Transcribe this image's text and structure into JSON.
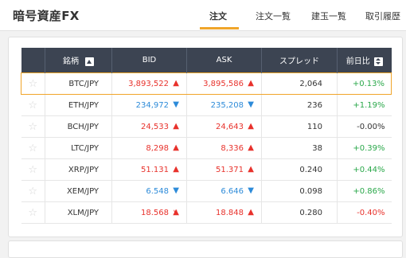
{
  "header": {
    "title": "暗号資産FX",
    "tabs": [
      {
        "label": "注文",
        "active": true
      },
      {
        "label": "注文一覧",
        "active": false
      },
      {
        "label": "建玉一覧",
        "active": false
      },
      {
        "label": "取引履歴",
        "active": false
      }
    ]
  },
  "colors": {
    "accent": "#f0a52a",
    "table_header_bg": "#3c4452",
    "up": "#e8322c",
    "down": "#2d8bd9",
    "positive_change": "#2aa84a",
    "negative_change": "#e8322c"
  },
  "table": {
    "columns": {
      "symbol": "銘柄",
      "bid": "BID",
      "ask": "ASK",
      "spread": "スプレッド",
      "change": "前日比"
    },
    "rows": [
      {
        "pair": "BTC/JPY",
        "bid": "3,893,522",
        "bid_dir": "up",
        "ask": "3,895,586",
        "ask_dir": "up",
        "spread": "2,064",
        "change": "+0.13%",
        "change_sign": "pos",
        "selected": true
      },
      {
        "pair": "ETH/JPY",
        "bid": "234,972",
        "bid_dir": "down",
        "ask": "235,208",
        "ask_dir": "down",
        "spread": "236",
        "change": "+1.19%",
        "change_sign": "pos",
        "selected": false
      },
      {
        "pair": "BCH/JPY",
        "bid": "24,533",
        "bid_dir": "up",
        "ask": "24,643",
        "ask_dir": "up",
        "spread": "110",
        "change": "-0.00%",
        "change_sign": "zero",
        "selected": false
      },
      {
        "pair": "LTC/JPY",
        "bid": "8,298",
        "bid_dir": "up",
        "ask": "8,336",
        "ask_dir": "up",
        "spread": "38",
        "change": "+0.39%",
        "change_sign": "pos",
        "selected": false
      },
      {
        "pair": "XRP/JPY",
        "bid": "51.131",
        "bid_dir": "up",
        "ask": "51.371",
        "ask_dir": "up",
        "spread": "0.240",
        "change": "+0.44%",
        "change_sign": "pos",
        "selected": false
      },
      {
        "pair": "XEM/JPY",
        "bid": "6.548",
        "bid_dir": "down",
        "ask": "6.646",
        "ask_dir": "down",
        "spread": "0.098",
        "change": "+0.86%",
        "change_sign": "pos",
        "selected": false
      },
      {
        "pair": "XLM/JPY",
        "bid": "18.568",
        "bid_dir": "up",
        "ask": "18.848",
        "ask_dir": "up",
        "spread": "0.280",
        "change": "-0.40%",
        "change_sign": "neg",
        "selected": false
      }
    ],
    "icons": {
      "favorite": "star-icon",
      "up": "arrow-up-icon",
      "down": "arrow-down-icon",
      "sort": "sort-icon"
    }
  }
}
